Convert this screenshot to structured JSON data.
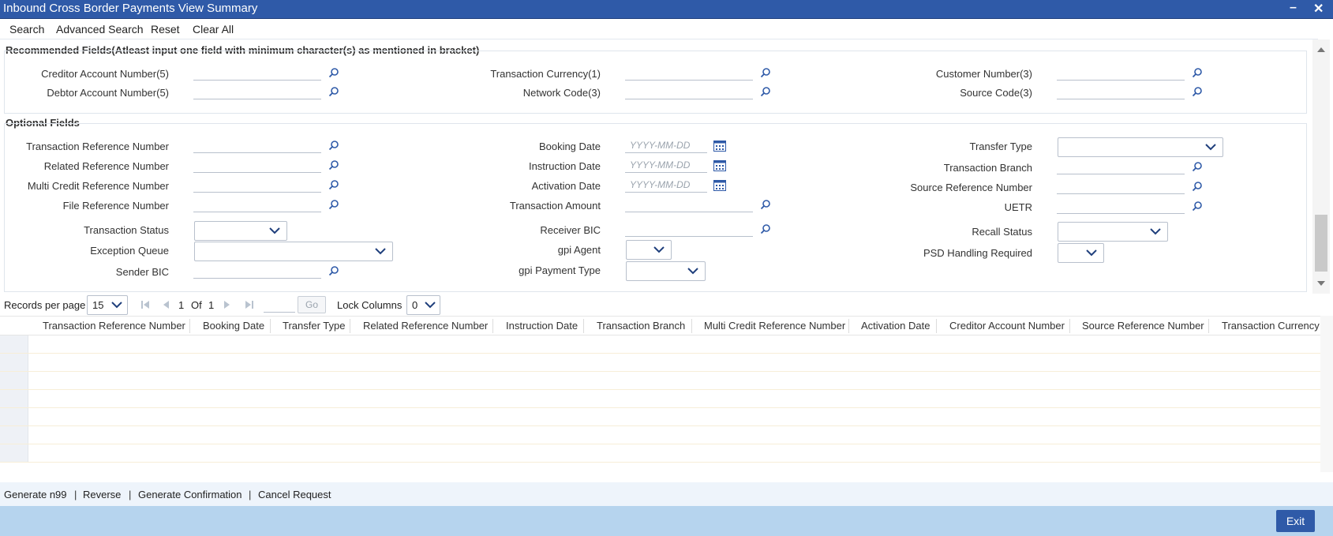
{
  "window": {
    "title": "Inbound Cross Border Payments View Summary"
  },
  "menu": {
    "search": "Search",
    "advanced_search": "Advanced Search",
    "reset": "Reset",
    "clear_all": "Clear All"
  },
  "recommended": {
    "title": "Recommended Fields(Atleast input one field with minimum character(s) as mentioned in bracket)",
    "creditor_account": "Creditor Account Number(5)",
    "debtor_account": "Debtor Account Number(5)",
    "transaction_currency": "Transaction Currency(1)",
    "network_code": "Network Code(3)",
    "customer_number": "Customer Number(3)",
    "source_code": "Source Code(3)"
  },
  "optional": {
    "title": "Optional Fields",
    "transaction_reference_number": "Transaction Reference Number",
    "related_reference_number": "Related Reference Number",
    "multi_credit_reference_number": "Multi Credit Reference Number",
    "file_reference_number": "File Reference Number",
    "transaction_status": "Transaction Status",
    "exception_queue": "Exception Queue",
    "sender_bic": "Sender BIC",
    "booking_date": "Booking Date",
    "instruction_date": "Instruction Date",
    "activation_date": "Activation Date",
    "transaction_amount": "Transaction Amount",
    "receiver_bic": "Receiver BIC",
    "gpi_agent": "gpi Agent",
    "gpi_payment_type": "gpi Payment Type",
    "transfer_type": "Transfer Type",
    "transaction_branch": "Transaction Branch",
    "source_reference_number": "Source Reference Number",
    "uetr": "UETR",
    "recall_status": "Recall Status",
    "psd_handling_required": "PSD Handling Required",
    "date_placeholder": "YYYY-MM-DD"
  },
  "pager": {
    "records_per_page_label": "Records per page",
    "records_per_page_value": "15",
    "current_page": "1",
    "of_label": "Of",
    "total_pages": "1",
    "go_label": "Go",
    "lock_columns_label": "Lock Columns",
    "lock_columns_value": "0"
  },
  "grid": {
    "columns": [
      "Transaction Reference Number",
      "Booking Date",
      "Transfer Type",
      "Related Reference Number",
      "Instruction Date",
      "Transaction Branch",
      "Multi Credit Reference Number",
      "Activation Date",
      "Creditor Account Number",
      "Source Reference Number",
      "Transaction Currency"
    ]
  },
  "actions": {
    "generate_n99": "Generate n99",
    "reverse": "Reverse",
    "generate_confirmation": "Generate Confirmation",
    "cancel_request": "Cancel Request",
    "separator": "|"
  },
  "footer": {
    "exit": "Exit"
  },
  "colors": {
    "title_bar": "#2f5aa8",
    "footer": "#b6d4ee",
    "accent": "#2f5aa8"
  },
  "icons": {
    "lookup": "search-icon",
    "calendar": "calendar-icon",
    "dropdown": "chevron-down-icon"
  }
}
